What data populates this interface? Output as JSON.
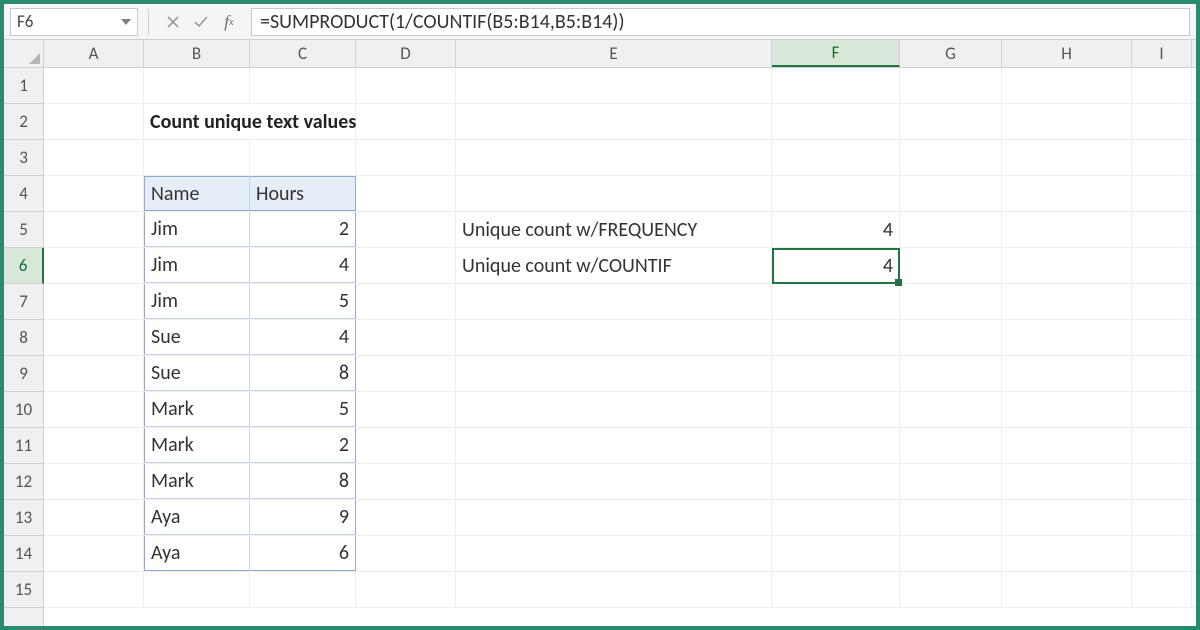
{
  "name_box": "F6",
  "formula": "=SUMPRODUCT(1/COUNTIF(B5:B14,B5:B14))",
  "columns": [
    "A",
    "B",
    "C",
    "D",
    "E",
    "F",
    "G",
    "H",
    "I"
  ],
  "active_col": "F",
  "rows": [
    "1",
    "2",
    "3",
    "4",
    "5",
    "6",
    "7",
    "8",
    "9",
    "10",
    "11",
    "12",
    "13",
    "14",
    "15"
  ],
  "active_row": "6",
  "title": "Count unique text values",
  "table": {
    "headers": {
      "name": "Name",
      "hours": "Hours"
    },
    "rows": [
      {
        "name": "Jim",
        "hours": "2"
      },
      {
        "name": "Jim",
        "hours": "4"
      },
      {
        "name": "Jim",
        "hours": "5"
      },
      {
        "name": "Sue",
        "hours": "4"
      },
      {
        "name": "Sue",
        "hours": "8"
      },
      {
        "name": "Mark",
        "hours": "5"
      },
      {
        "name": "Mark",
        "hours": "2"
      },
      {
        "name": "Mark",
        "hours": "8"
      },
      {
        "name": "Aya",
        "hours": "9"
      },
      {
        "name": "Aya",
        "hours": "6"
      }
    ]
  },
  "labels": {
    "freq": "Unique count w/FREQUENCY",
    "countif": "Unique count w/COUNTIF"
  },
  "results": {
    "freq": "4",
    "countif": "4"
  }
}
